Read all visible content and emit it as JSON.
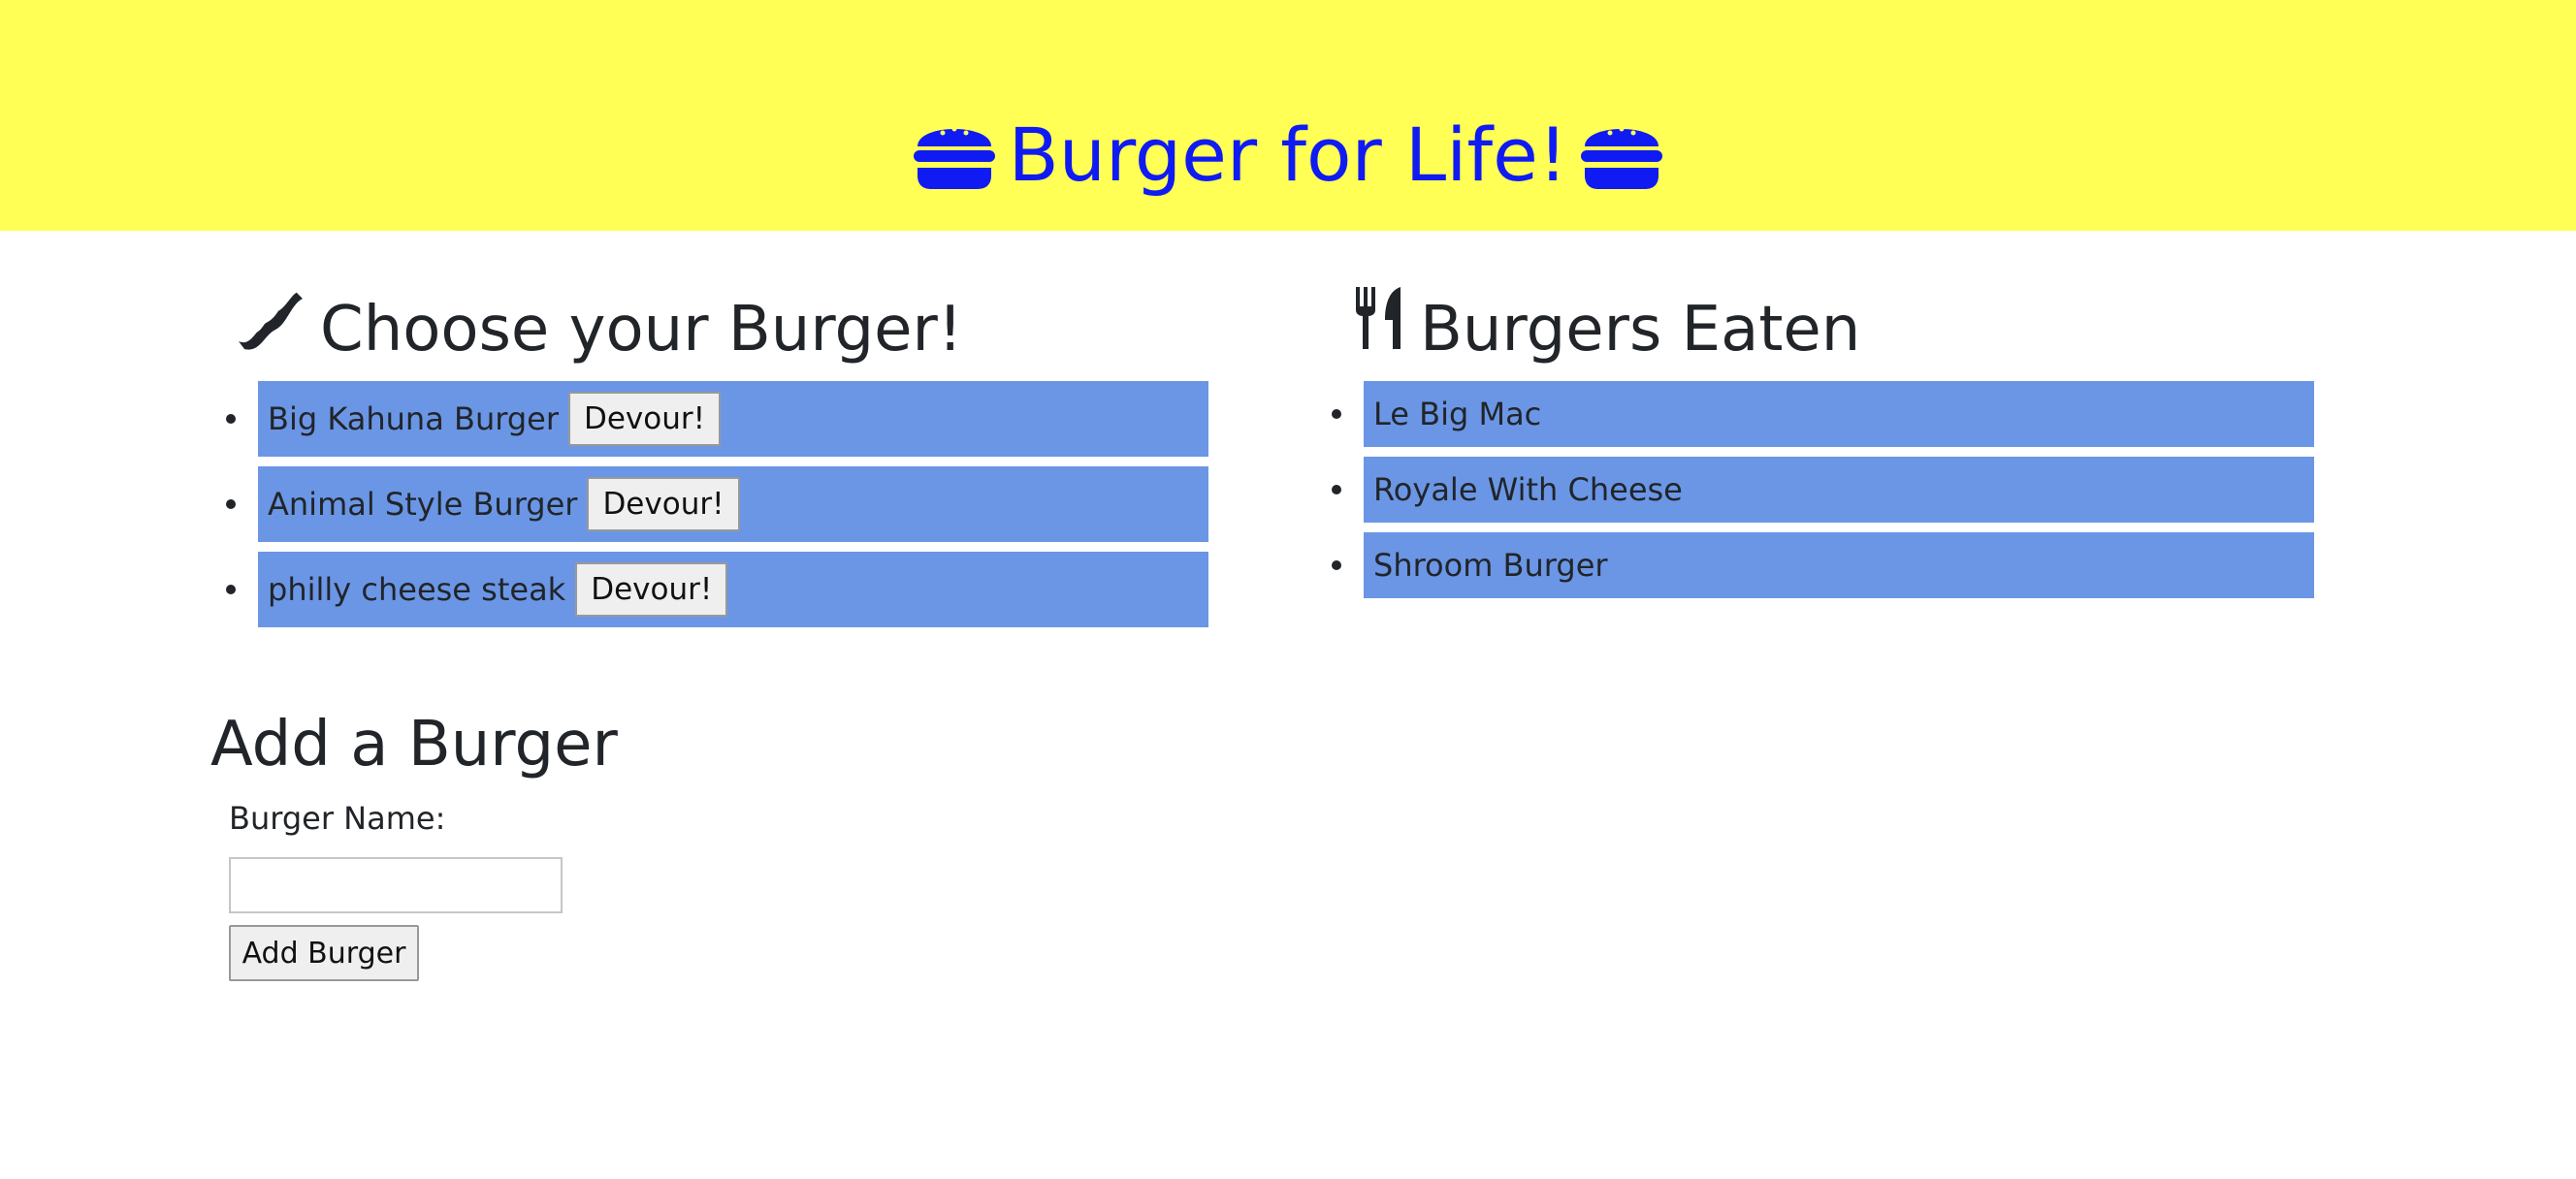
{
  "header": {
    "title": "Burger for Life!",
    "left_icon": "hamburger-icon",
    "right_icon": "hamburger-icon",
    "background_color": "#ffff55",
    "title_color": "#0f1bf2"
  },
  "uneaten": {
    "title": "Choose your Burger!",
    "icon": "bacon-icon",
    "items": [
      {
        "name": "Big Kahuna Burger",
        "button": "Devour!"
      },
      {
        "name": "Animal Style Burger",
        "button": "Devour!"
      },
      {
        "name": "philly cheese steak",
        "button": "Devour!"
      }
    ]
  },
  "eaten": {
    "title": "Burgers Eaten",
    "icon": "utensils-icon",
    "items": [
      {
        "name": "Le Big Mac"
      },
      {
        "name": "Royale With Cheese"
      },
      {
        "name": "Shroom Burger"
      }
    ]
  },
  "add_form": {
    "title": "Add a Burger",
    "label": "Burger Name:",
    "input_value": "",
    "input_placeholder": "",
    "submit_label": "Add Burger"
  },
  "item_color": "#6b96e6"
}
